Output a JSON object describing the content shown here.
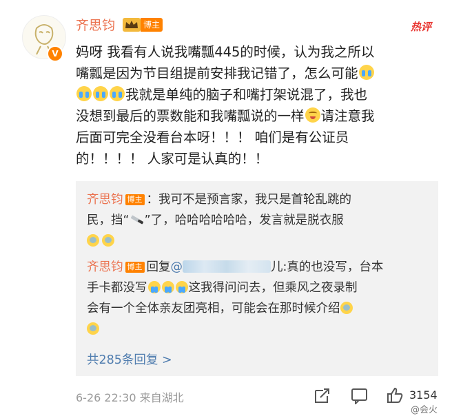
{
  "post": {
    "username": "齐思钧",
    "host_badge": "博主",
    "hot_label": "热评",
    "lines": [
      "妈呀 我看有人说我嘴瓢445的时候，认为我之所以",
      "嘴瓢是因为节目组提前安排我记错了，怎么可能",
      "我就是单纯的脑子和嘴打架说混了，我也",
      "没想到最后的票数能和我嘴瓢说的一样",
      "请注意我",
      "后面可完全没看台本呀！！！ 咱们是有公证员",
      "的！！！！ 人家可是认真的！！"
    ]
  },
  "replies": {
    "r1": {
      "name": "齐思钧",
      "badge": "博主",
      "text1": "：我可不是预言家，我只是首轮乱跳的",
      "text2a": "民，挡“",
      "text2b": "”了，哈哈哈哈哈哈，发言就是脱衣服"
    },
    "r2": {
      "name": "齐思钧",
      "badge": "博主",
      "reply_word": "回复",
      "at": "@",
      "mention_tail": "儿",
      "text1": ":真的也没写，台本",
      "text2a": "手卡都没写",
      "text2b": "这我得问问去，但乘风之夜录制",
      "text3": "会有一个全体亲友团亮相，可能会在那时候介绍"
    },
    "total": "共285条回复 >"
  },
  "footer": {
    "time": "6-26 22:30 来自湖北",
    "likes": "3154",
    "watermark": "@会火"
  }
}
